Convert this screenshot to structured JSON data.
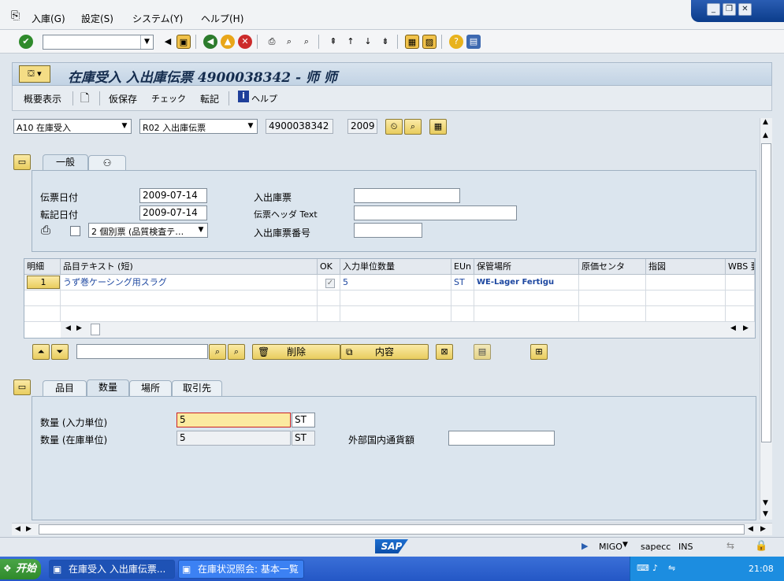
{
  "menu": [
    "入庫(G)",
    "設定(S)",
    "システム(Y)",
    "ヘルプ(H)"
  ],
  "title": "在庫受入 入出庫伝票 4900038342 - 师 师",
  "app_toolbar": {
    "overview": "概要表示",
    "hold": "仮保存",
    "check": "チェック",
    "post": "転記",
    "help": "ヘルプ"
  },
  "header": {
    "action": "A10 在庫受入",
    "ref_doc": "R02 入出庫伝票",
    "doc_number": "4900038342",
    "year": "2009"
  },
  "general_tab": {
    "tabs": [
      "一般"
    ],
    "doc_date_label": "伝票日付",
    "doc_date": "2009-07-14",
    "post_date_label": "転記日付",
    "post_date": "2009-07-14",
    "print_option": "2 個別票 (品質検査テ…",
    "delivery_note_label": "入出庫票",
    "header_text_label": "伝票ヘッダ Text",
    "bill_label": "入出庫票番号"
  },
  "grid": {
    "headers": [
      "明細",
      "品目テキスト (短)",
      "OK",
      "入力単位数量",
      "EUn",
      "保管場所",
      "原価センタ",
      "指図",
      "WBS 要"
    ],
    "rows": [
      {
        "line": "1",
        "text": "うず巻ケーシング用スラグ",
        "qty": "5",
        "unit": "ST",
        "sloc": "WE-Lager Fertigu"
      }
    ]
  },
  "item_actions": {
    "delete": "削除",
    "contents": "内容"
  },
  "detail_tabs": [
    "品目",
    "数量",
    "場所",
    "取引先"
  ],
  "detail": {
    "qty_entry_label": "数量 (入力単位)",
    "qty_entry": "5",
    "qty_entry_unit": "ST",
    "qty_stock_label": "数量 (在庫単位)",
    "qty_stock": "5",
    "qty_stock_unit": "ST",
    "ext_amount_label": "外部国内通貨額"
  },
  "status": {
    "tcode": "MIGO",
    "server": "sapecc",
    "mode": "INS",
    "logo": "SAP"
  },
  "taskbar": {
    "start": "开始",
    "tasks": [
      "在庫受入 入出庫伝票...",
      "在庫状況照会: 基本一覧"
    ],
    "clock": "21:08"
  }
}
